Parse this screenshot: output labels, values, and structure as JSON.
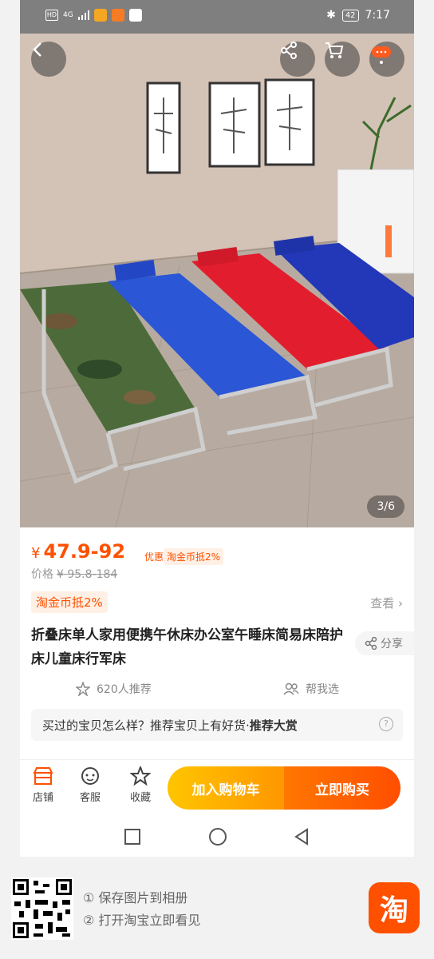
{
  "statusbar": {
    "net": "4G",
    "battery": "42",
    "time": "7:17"
  },
  "hero": {
    "counter": "3/6"
  },
  "price": {
    "currency": "¥",
    "value": "47.9-92",
    "promo_label": "优惠价",
    "coin_tag": "淘金币抵2%",
    "orig_label": "价格",
    "orig_value": "¥ 95.8-184"
  },
  "coin": {
    "badge": "淘金币抵2%",
    "view": "查看"
  },
  "product": {
    "title": "折叠床单人家用便携午休床办公室午睡床简易床陪护床儿童床行军床",
    "share": "分享"
  },
  "recommend": {
    "count": "620人推荐",
    "help": "帮我选"
  },
  "review": {
    "text": "买过的宝贝怎么样？推荐宝贝上有好货·",
    "bold": "推荐大赏",
    "help_icon": "?"
  },
  "bottombar": {
    "shop": "店铺",
    "service": "客服",
    "favorite": "收藏",
    "add_cart": "加入购物车",
    "buy_now": "立即购买"
  },
  "footer": {
    "step1": "① 保存图片到相册",
    "step2": "② 打开淘宝立即看见",
    "logo": "淘"
  }
}
